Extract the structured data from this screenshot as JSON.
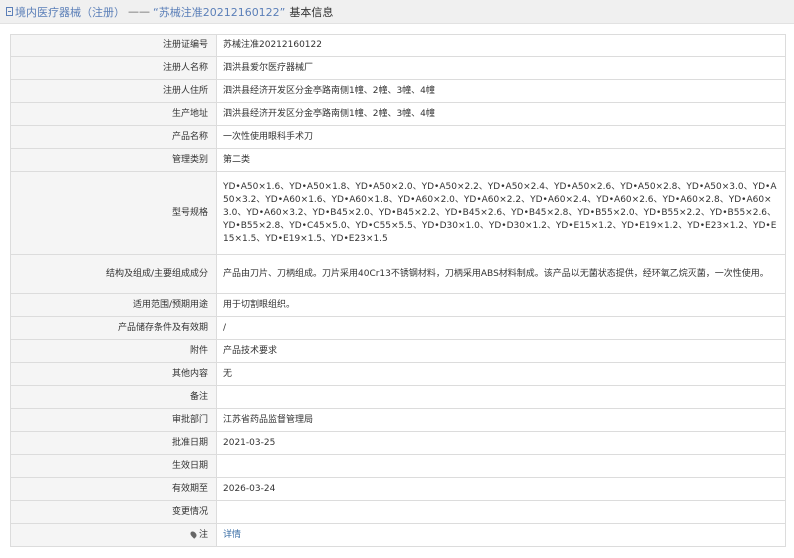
{
  "header": {
    "category": "境内医疗器械（注册）",
    "dash": "——",
    "reg_quoted": "“苏械注准20212160122”",
    "suffix": "基本信息"
  },
  "rows": [
    {
      "label": "注册证编号",
      "value": "苏械注准20212160122"
    },
    {
      "label": "注册人名称",
      "value": "泗洪县爱尔医疗器械厂"
    },
    {
      "label": "注册人住所",
      "value": "泗洪县经济开发区分金亭路南侧1幢、2幢、3幢、4幢"
    },
    {
      "label": "生产地址",
      "value": "泗洪县经济开发区分金亭路南侧1幢、2幢、3幢、4幢"
    },
    {
      "label": "产品名称",
      "value": "一次性使用眼科手术刀"
    },
    {
      "label": "管理类别",
      "value": "第二类"
    },
    {
      "label": "型号规格",
      "value": "YD•A50×1.6、YD•A50×1.8、YD•A50×2.0、YD•A50×2.2、YD•A50×2.4、YD•A50×2.6、YD•A50×2.8、YD•A50×3.0、YD•A50×3.2、YD•A60×1.6、YD•A60×1.8、YD•A60×2.0、YD•A60×2.2、YD•A60×2.4、YD•A60×2.6、YD•A60×2.8、YD•A60×3.0、YD•A60×3.2、YD•B45×2.0、YD•B45×2.2、YD•B45×2.6、YD•B45×2.8、YD•B55×2.0、YD•B55×2.2、YD•B55×2.6、YD•B55×2.8、YD•C45×5.0、YD•C55×5.5、YD•D30×1.0、YD•D30×1.2、YD•E15×1.2、YD•E19×1.2、YD•E23×1.2、YD•E15×1.5、YD•E19×1.5、YD•E23×1.5"
    },
    {
      "label": "结构及组成/主要组成成分",
      "value": "产品由刀片、刀柄组成。刀片采用40Cr13不锈钢材料，刀柄采用ABS材料制成。该产品以无菌状态提供，经环氧乙烷灭菌，一次性使用。"
    },
    {
      "label": "适用范围/预期用途",
      "value": "用于切割眼组织。"
    },
    {
      "label": "产品储存条件及有效期",
      "value": "/"
    },
    {
      "label": "附件",
      "value": "产品技术要求"
    },
    {
      "label": "其他内容",
      "value": "无"
    },
    {
      "label": "备注",
      "value": ""
    },
    {
      "label": "审批部门",
      "value": "江苏省药品监督管理局"
    },
    {
      "label": "批准日期",
      "value": "2021-03-25"
    },
    {
      "label": "生效日期",
      "value": ""
    },
    {
      "label": "有效期至",
      "value": "2026-03-24"
    },
    {
      "label": "变更情况",
      "value": ""
    }
  ],
  "note": {
    "label": "注",
    "link": "详情"
  }
}
